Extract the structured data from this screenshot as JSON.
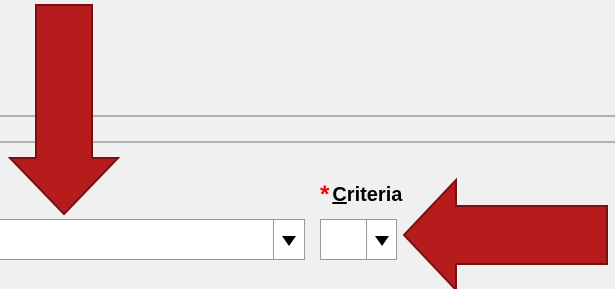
{
  "form": {
    "criteria_label": {
      "required_marker": "*",
      "mnemonic_letter": "C",
      "rest": "riteria"
    },
    "first_select": {
      "value": ""
    },
    "criteria_select": {
      "value": ""
    }
  },
  "colors": {
    "background": "#f0f0f0",
    "arrow_fill": "#b71c1c",
    "arrow_stroke": "#7a1010",
    "required_marker": "#ff0000"
  },
  "icons": {
    "dropdown": "chevron-down-icon",
    "annotation": "arrow-icon"
  }
}
